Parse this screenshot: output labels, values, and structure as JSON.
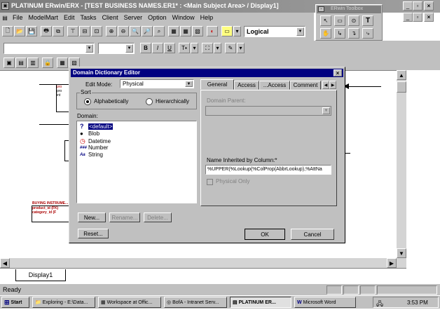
{
  "app": {
    "title": "PLATINUM ERwin/ERX - [TEST BUSINESS NAMES.ER1* : <Main Subject Area> / Display1]",
    "menu": [
      "File",
      "ModelMart",
      "Edit",
      "Tasks",
      "Client",
      "Server",
      "Option",
      "Window",
      "Help"
    ],
    "view_dropdown": "Logical",
    "font_bold": "B",
    "font_italic": "I",
    "font_underline": "U",
    "toolbox_title": "ERwin Toolbox"
  },
  "diagram": {
    "tab_label": "Display1",
    "entity_buying_title": "BUYING INSTRUME...",
    "entity_buying_rows": [
      "product_id (FK)",
      "category_id (F"
    ],
    "entity_small_rows": [
      "pro",
      "pro",
      "int"
    ]
  },
  "dialog": {
    "title": "Domain Dictionary Editor",
    "edit_mode_label": "Edit Mode:",
    "edit_mode_value": "Physical",
    "sort_group": "Sort",
    "sort_alpha": "Alphabetically",
    "sort_hier": "Hierarchically",
    "domain_label": "Domain:",
    "domains": [
      {
        "icon": "?",
        "label": "<default>",
        "selected": true
      },
      {
        "icon": "●",
        "label": "Blob"
      },
      {
        "icon": "◷",
        "label": "Datetime"
      },
      {
        "icon": "###",
        "label": "Number"
      },
      {
        "icon": "Aa",
        "label": "String"
      }
    ],
    "tabs": [
      "General",
      "Access",
      "...Access",
      "Comment"
    ],
    "domain_parent_label": "Domain Parent:",
    "name_inherited_label": "Name Inherited by Column:*",
    "name_inherited_value": "%UPPER(%Lookup(%ColProp(AbbrLookup),%AttNa",
    "physical_only_label": "Physical Only",
    "btn_new": "New...",
    "btn_rename": "Rename...",
    "btn_delete": "Delete...",
    "btn_reset": "Reset...",
    "btn_ok": "OK",
    "btn_cancel": "Cancel"
  },
  "status": {
    "text": "Ready"
  },
  "taskbar": {
    "start": "Start",
    "items": [
      "Exploring - E:\\Data...",
      "Workspace at Offic...",
      "BofA - Intranet Serv...",
      "PLATINUM ER...",
      "Microsoft Word"
    ],
    "clock": "3:53 PM"
  }
}
